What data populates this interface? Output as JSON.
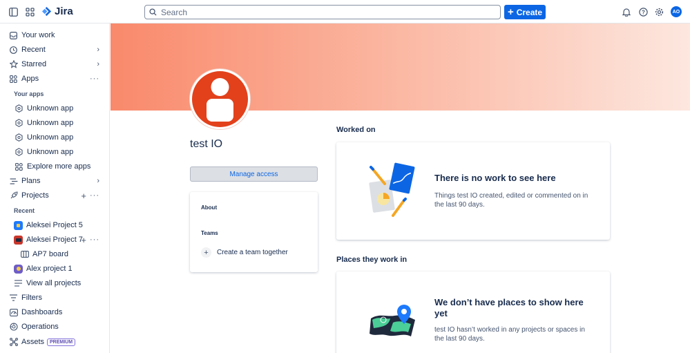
{
  "topbar": {
    "app_name": "Jira",
    "search_placeholder": "Search",
    "create_label": "Create",
    "avatar_initials": "AO"
  },
  "sidebar": {
    "your_work": "Your work",
    "recent": "Recent",
    "starred": "Starred",
    "apps": "Apps",
    "your_apps_heading": "Your apps",
    "apps_list": [
      "Unknown app",
      "Unknown app",
      "Unknown app",
      "Unknown app"
    ],
    "explore_apps": "Explore more apps",
    "plans": "Plans",
    "projects": "Projects",
    "recent_heading": "Recent",
    "project_1": "Aleksei Project 5",
    "project_2": "Aleksei Project 7",
    "board": "AP7 board",
    "project_3": "Alex project 1",
    "view_all": "View all projects",
    "filters": "Filters",
    "dashboards": "Dashboards",
    "operations": "Operations",
    "assets": "Assets",
    "assets_badge": "PREMIUM"
  },
  "profile": {
    "name": "test IO",
    "manage_access": "Manage access",
    "about_heading": "About",
    "teams_heading": "Teams",
    "create_team": "Create a team together"
  },
  "worked_on": {
    "title": "Worked on",
    "empty_heading": "There is no work to see here",
    "empty_text": "Things test IO created, edited or commented on in the last 90 days."
  },
  "places": {
    "title": "Places they work in",
    "empty_heading": "We don’t have places to show here yet",
    "empty_text": "test IO hasn’t worked in any projects or spaces in the last 90 days."
  },
  "colors": {
    "brand_blue": "#0c66e4",
    "avatar_red": "#e2411c",
    "banner_start": "#f9896b"
  }
}
